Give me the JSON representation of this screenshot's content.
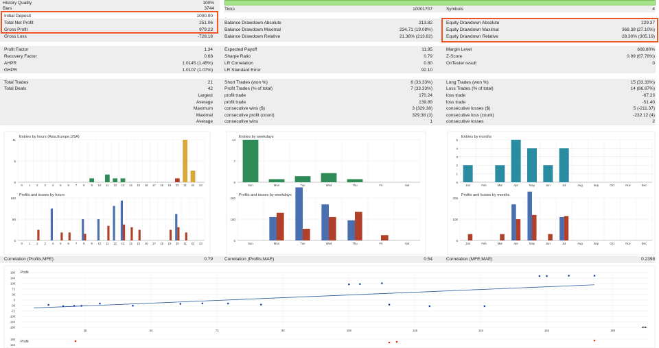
{
  "summary_top": {
    "history_quality_label": "History Quality",
    "history_quality_value": "100%",
    "bars_label": "Bars",
    "bars_value": "3744",
    "ticks_label": "Ticks",
    "ticks_value": "10001707",
    "symbols_label": "Symbols",
    "symbols_value": "4"
  },
  "col1": [
    {
      "label": "Initial Deposit",
      "value": "1000.00"
    },
    {
      "label": "Total Net Profit",
      "value": "251.06"
    },
    {
      "label": "Gross Profit",
      "value": "979.23"
    },
    {
      "label": "Gross Loss",
      "value": "-728.18"
    }
  ],
  "col2": [
    {
      "label": "Balance Drawdown Absolute",
      "value": "213.82"
    },
    {
      "label": "Balance Drawdown Maximal",
      "value": "234.71 (19.08%)"
    },
    {
      "label": "Balance Drawdown Relative",
      "value": "21.38% (213.82)"
    }
  ],
  "col3": [
    {
      "label": "Equity Drawdown Absolute",
      "value": "229.37"
    },
    {
      "label": "Equity Drawdown Maximal",
      "value": "368.38 (27.10%)"
    },
    {
      "label": "Equity Drawdown Relative",
      "value": "28.30% (305.19)"
    }
  ],
  "ratios_col1": [
    {
      "label": "Profit Factor",
      "value": "1.34"
    },
    {
      "label": "Recovery Factor",
      "value": "0.68"
    },
    {
      "label": "AHPR",
      "value": "1.0145 (1.45%)"
    },
    {
      "label": "GHPR",
      "value": "1.0107 (1.07%)"
    }
  ],
  "ratios_col2": [
    {
      "label": "Expected Payoff",
      "value": "11.95"
    },
    {
      "label": "Sharpe Ratio",
      "value": "0.79"
    },
    {
      "label": "LR Correlation",
      "value": "0.80"
    },
    {
      "label": "LR Standard Error",
      "value": "92.10"
    }
  ],
  "ratios_col3": [
    {
      "label": "Margin Level",
      "value": "608.80%"
    },
    {
      "label": "Z-Score",
      "value": "0.99 (67.78%)"
    },
    {
      "label": "OnTester result",
      "value": "0"
    }
  ],
  "trades_col1": [
    {
      "label": "Total Trades",
      "value": "21"
    },
    {
      "label": "Total Deals",
      "value": "42"
    }
  ],
  "trades_sub_labels": [
    "Largest",
    "Average",
    "Maximum",
    "Maximal",
    "Average"
  ],
  "trades_col2": [
    {
      "label": "Short Trades (won %)",
      "value": "6 (33.33%)"
    },
    {
      "label": "Profit Trades (% of total)",
      "value": "7 (33.33%)"
    },
    {
      "label": "profit trade",
      "value": "170.24"
    },
    {
      "label": "profit trade",
      "value": "139.89"
    },
    {
      "label": "consecutive wins ($)",
      "value": "3 (329.38)"
    },
    {
      "label": "consecutive profit (count)",
      "value": "329.38 (3)"
    },
    {
      "label": "consecutive wins",
      "value": "1"
    }
  ],
  "trades_col3": [
    {
      "label": "Long Trades (won %)",
      "value": "15 (33.33%)"
    },
    {
      "label": "Loss Trades (% of total)",
      "value": "14 (66.67%)"
    },
    {
      "label": "loss trade",
      "value": "-67.23"
    },
    {
      "label": "loss trade",
      "value": "-51.40"
    },
    {
      "label": "consecutive losses ($)",
      "value": "5 (-211.37)"
    },
    {
      "label": "consecutive loss (count)",
      "value": "-232.12 (4)"
    },
    {
      "label": "consecutive losses",
      "value": "2"
    }
  ],
  "colors": {
    "orange_entries": "#d9a63a",
    "green_entries": "#2e8b57",
    "teal_entries": "#2a8ca0",
    "blue_profit": "#4a6fb0",
    "red_loss": "#b0402a",
    "highlight": "#ee5522",
    "regression": "#2a5aa0"
  },
  "chart_data": [
    {
      "type": "bar",
      "title": "Entries by hours (Asia,Europe,USA)",
      "categories": [
        "0",
        "1",
        "2",
        "3",
        "4",
        "5",
        "6",
        "7",
        "8",
        "9",
        "10",
        "11",
        "12",
        "13",
        "14",
        "15",
        "16",
        "17",
        "18",
        "19",
        "20",
        "21",
        "22",
        "23"
      ],
      "values": [
        0,
        0,
        0,
        0,
        0,
        0,
        0,
        0,
        0,
        1,
        0,
        2,
        1,
        1,
        0,
        0,
        0,
        0,
        0,
        0,
        1,
        11,
        3,
        0
      ],
      "ylim": [
        0,
        11
      ],
      "yticks": [
        "0",
        "5",
        "11"
      ]
    },
    {
      "type": "bar",
      "title": "Entries by weekdays",
      "categories": [
        "Sun",
        "Mon",
        "Tue",
        "Wed",
        "Thu",
        "Fri",
        "Sat"
      ],
      "values": [
        14,
        1,
        2,
        3,
        1,
        0,
        0
      ],
      "ylim": [
        0,
        14
      ],
      "yticks": [
        "0",
        "7",
        "14"
      ]
    },
    {
      "type": "bar",
      "title": "Entries by months",
      "categories": [
        "Jan",
        "Feb",
        "Mar",
        "Apr",
        "May",
        "Jun",
        "Jul",
        "Aug",
        "Sep",
        "Oct",
        "Nov",
        "Dec"
      ],
      "values": [
        2,
        0,
        2,
        5,
        4,
        2,
        4,
        0,
        0,
        0,
        0,
        0
      ],
      "ylim": [
        0,
        5
      ],
      "yticks": [
        "0",
        "1",
        "2",
        "3",
        "4",
        "5"
      ]
    },
    {
      "type": "bar",
      "title": "Profits and losses by hours",
      "categories": [
        "0",
        "1",
        "2",
        "3",
        "4",
        "5",
        "6",
        "7",
        "8",
        "9",
        "10",
        "11",
        "12",
        "13",
        "14",
        "15",
        "16",
        "17",
        "18",
        "19",
        "20",
        "21",
        "22",
        "23"
      ],
      "series": [
        {
          "values": [
            0,
            0,
            0,
            0,
            120,
            0,
            0,
            0,
            80,
            0,
            80,
            0,
            130,
            150,
            0,
            0,
            0,
            0,
            0,
            0,
            100,
            0,
            0,
            0
          ]
        },
        {
          "values": [
            0,
            0,
            40,
            0,
            0,
            30,
            30,
            0,
            25,
            0,
            0,
            55,
            0,
            60,
            50,
            40,
            0,
            0,
            0,
            40,
            50,
            30,
            0,
            0
          ]
        }
      ],
      "ylim": [
        0,
        160
      ],
      "yticks": [
        "0",
        "80",
        "160"
      ]
    },
    {
      "type": "bar",
      "title": "Profits and losses by weekdays",
      "categories": [
        "Sun",
        "Mon",
        "Tue",
        "Wed",
        "Thu",
        "Fri",
        "Sat"
      ],
      "series": [
        {
          "values": [
            0,
            110,
            250,
            170,
            95,
            0,
            0
          ]
        },
        {
          "values": [
            0,
            130,
            55,
            110,
            135,
            25,
            0
          ]
        }
      ],
      "ylim": [
        0,
        200
      ],
      "yticks": [
        "0",
        "100",
        "200"
      ]
    },
    {
      "type": "bar",
      "title": "Profits and losses by months",
      "categories": [
        "Jan",
        "Feb",
        "Mar",
        "Apr",
        "May",
        "Jun",
        "Jul",
        "Aug",
        "Sep",
        "Oct",
        "Nov",
        "Dec"
      ],
      "series": [
        {
          "values": [
            0,
            0,
            0,
            170,
            230,
            0,
            110,
            0,
            0,
            0,
            0,
            0
          ]
        },
        {
          "values": [
            30,
            0,
            30,
            100,
            120,
            30,
            115,
            0,
            0,
            0,
            0,
            0
          ]
        }
      ],
      "ylim": [
        0,
        200
      ],
      "yticks": [
        "0",
        "100",
        "200"
      ]
    },
    {
      "type": "scatter",
      "title": "Profit",
      "yticks": [
        "180",
        "144",
        "108",
        "72",
        "36",
        "0",
        "-36",
        "-72",
        "-108",
        "-144",
        "-180"
      ],
      "xticks": [
        "36",
        "54",
        "72",
        "90",
        "108",
        "126",
        "144",
        "162",
        "180"
      ],
      "ylim": [
        -180,
        180
      ],
      "xlim": [
        18,
        190
      ],
      "points": [
        [
          26,
          -32
        ],
        [
          30,
          -40
        ],
        [
          33,
          -38
        ],
        [
          35,
          -38
        ],
        [
          40,
          -23
        ],
        [
          49,
          -37
        ],
        [
          62,
          -25
        ],
        [
          68,
          -22
        ],
        [
          75,
          -23
        ],
        [
          84,
          -30
        ],
        [
          108,
          103
        ],
        [
          111,
          105
        ],
        [
          117,
          110
        ],
        [
          119,
          -30
        ],
        [
          130,
          -40
        ],
        [
          145,
          -40
        ],
        [
          160,
          158
        ],
        [
          162,
          158
        ],
        [
          168,
          160
        ],
        [
          175,
          160
        ]
      ],
      "regression": [
        [
          22,
          -52
        ],
        [
          175,
          100
        ]
      ]
    }
  ],
  "correlations": [
    {
      "label": "Correlation (Profits,MFE)",
      "value": "0.79"
    },
    {
      "label": "Correlation (Profits,MAE)",
      "value": "0.54"
    },
    {
      "label": "Correlation (MFE,MAE)",
      "value": "0.2398"
    }
  ],
  "scatter_bottom": {
    "label": "Profit",
    "yticks": [
      "180",
      "144"
    ]
  },
  "scroll_marker": "▸▸▸"
}
